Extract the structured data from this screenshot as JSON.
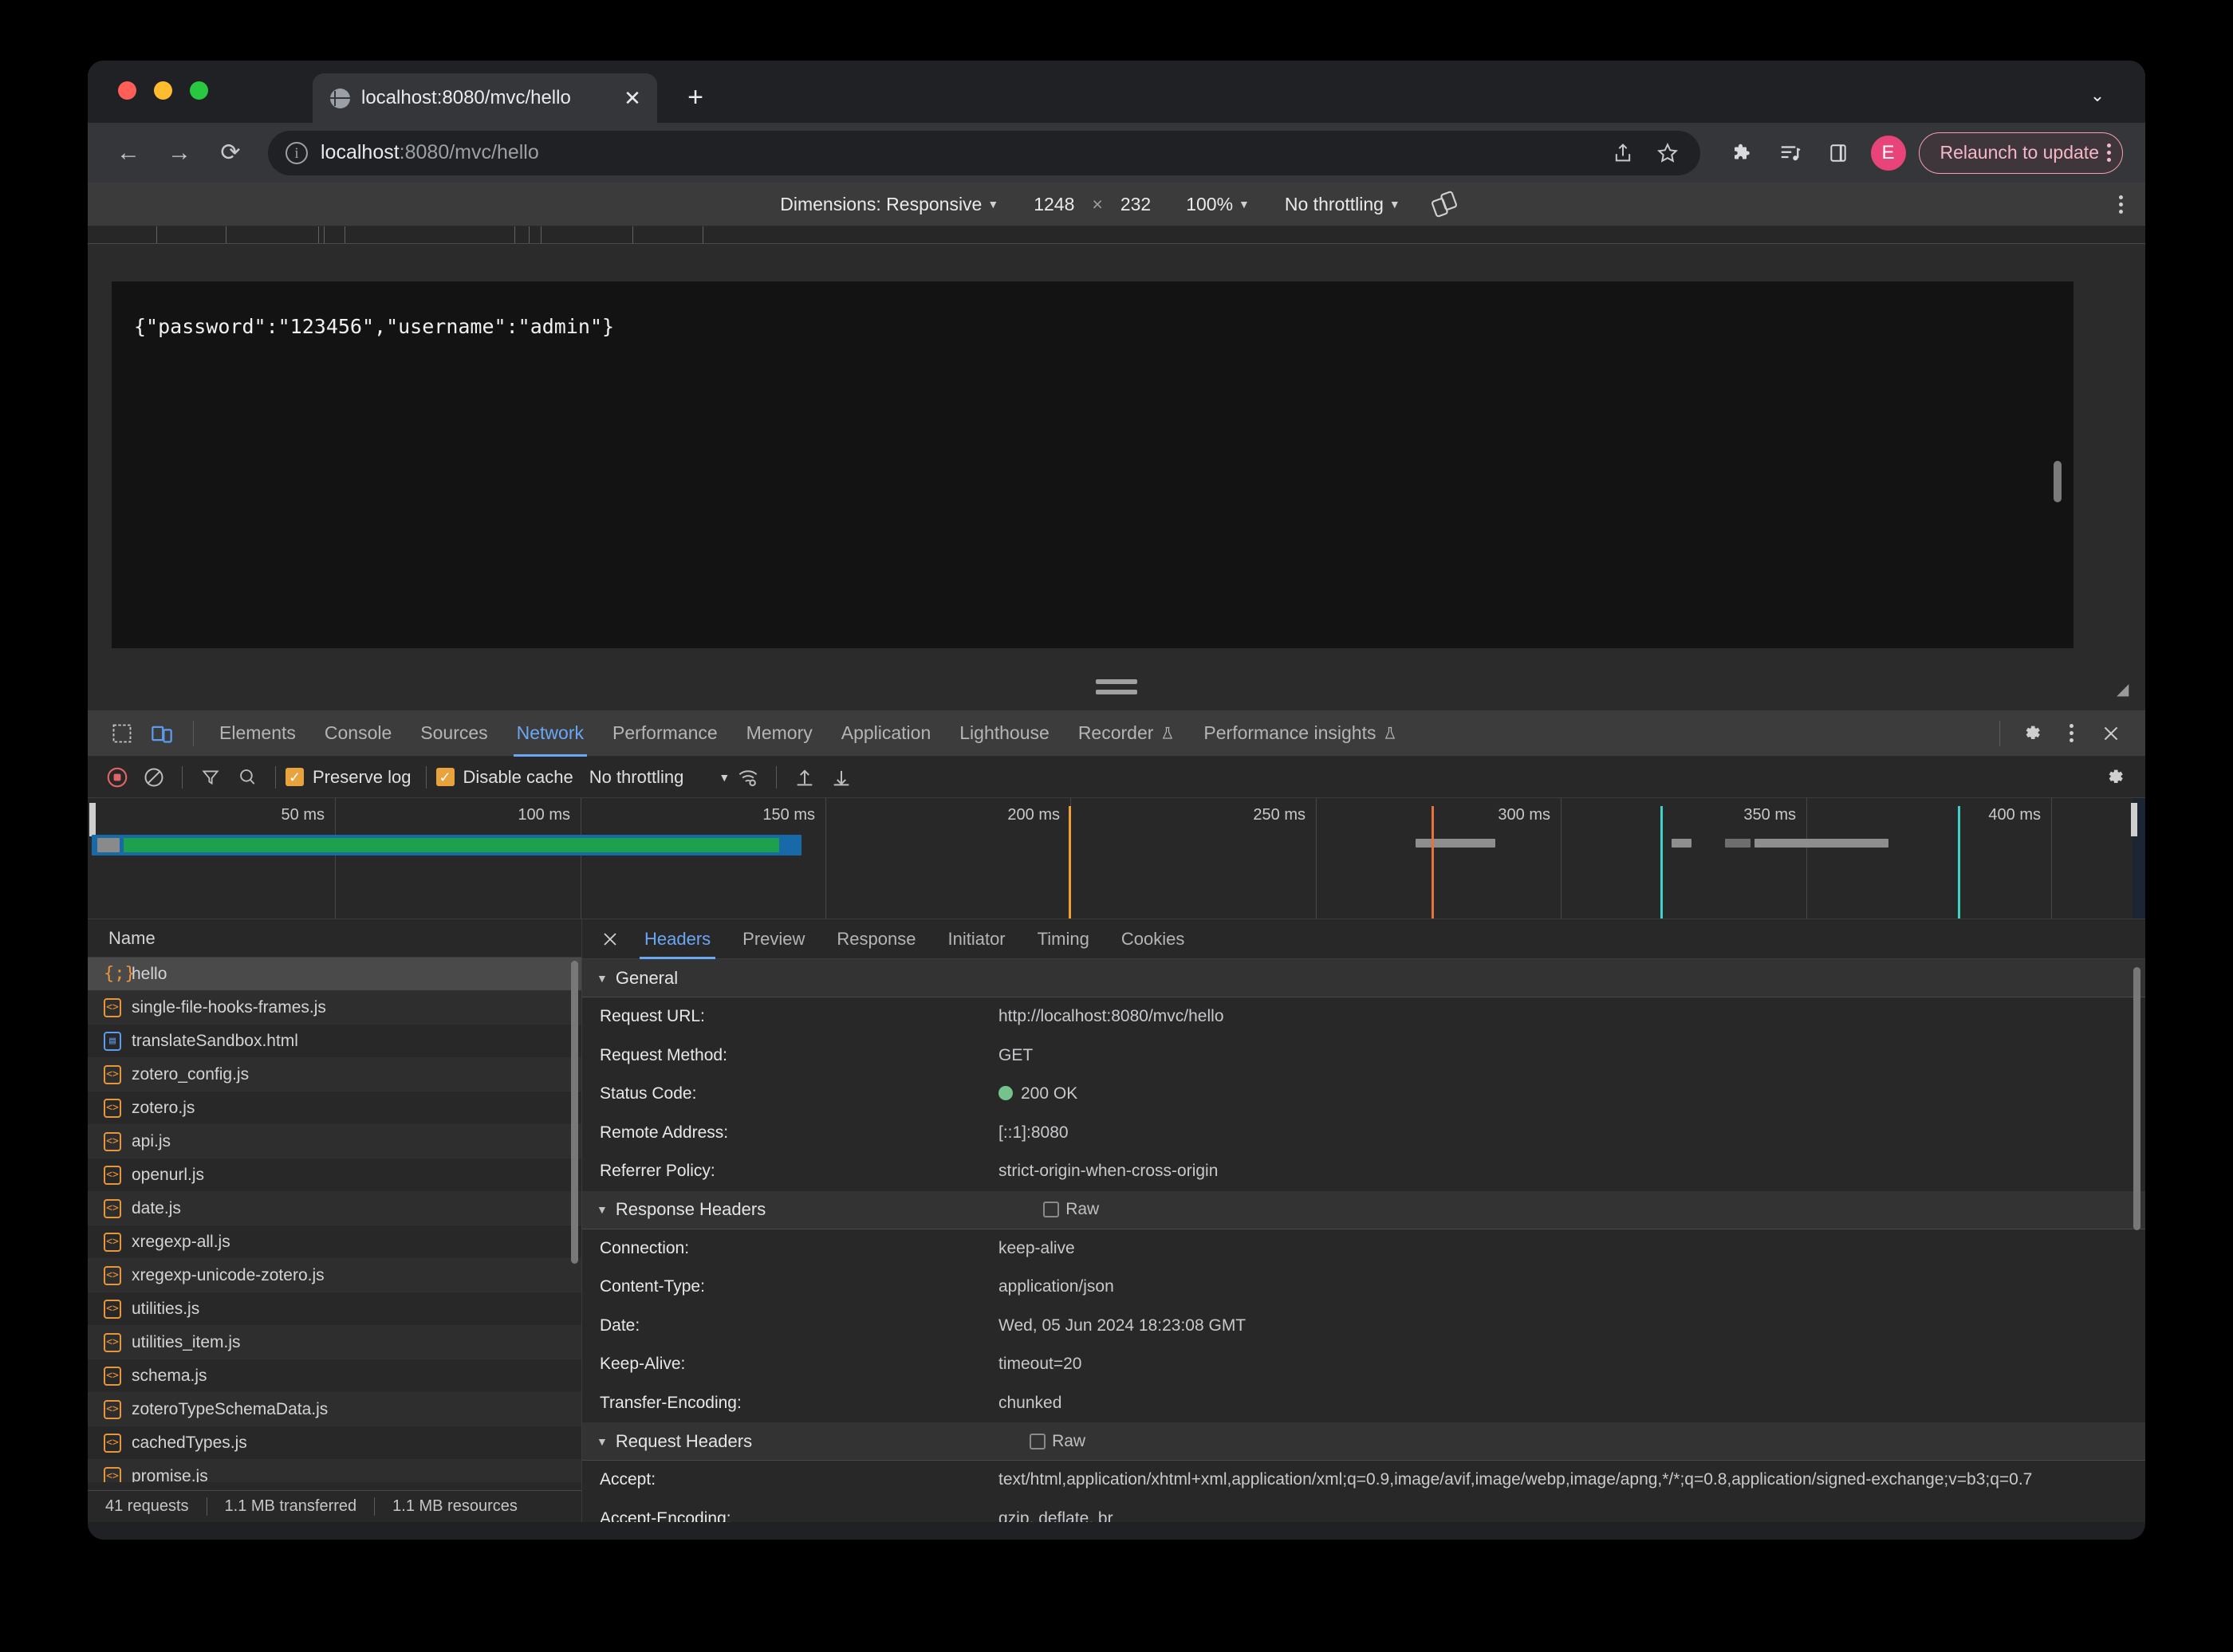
{
  "browser": {
    "tab": {
      "title": "localhost:8080/mvc/hello",
      "favicon": "globe-icon",
      "close": "✕"
    },
    "new_tab": "+",
    "tab_list_chevron": "⌄",
    "nav": {
      "back": "←",
      "forward": "→",
      "reload": "⟳"
    },
    "omnibox": {
      "site_info_icon": "info-icon",
      "url_bold": "localhost",
      "url_rest": ":8080/mvc/hello",
      "full_url": "localhost:8080/mvc/hello"
    },
    "toolbar": {
      "share_icon": "share-icon",
      "bookmark_icon": "star-icon",
      "extensions_icon": "puzzle-icon",
      "reading_list_icon": "media-list-icon",
      "side_panel_icon": "side-panel-icon",
      "profile_initial": "E",
      "relaunch_label": "Relaunch to update",
      "relaunch_menu": "kebab-icon",
      "relaunch_color": "#f6b8c8"
    }
  },
  "device_toolbar": {
    "dimensions_label": "Dimensions: Responsive",
    "width": "1248",
    "times": "×",
    "height": "232",
    "zoom": "100%",
    "throttling": "No throttling",
    "rotate_icon": "rotate-icon",
    "menu_icon": "kebab-icon"
  },
  "viewport": {
    "body_text": "{\"password\":\"123456\",\"username\":\"admin\"}"
  },
  "devtools": {
    "inspect_icon": "inspect-icon",
    "device_toggle_icon": "device-toolbar-icon",
    "tabs": [
      {
        "label": "Elements",
        "active": false,
        "flask": false
      },
      {
        "label": "Console",
        "active": false,
        "flask": false
      },
      {
        "label": "Sources",
        "active": false,
        "flask": false
      },
      {
        "label": "Network",
        "active": true,
        "flask": false
      },
      {
        "label": "Performance",
        "active": false,
        "flask": false
      },
      {
        "label": "Memory",
        "active": false,
        "flask": false
      },
      {
        "label": "Application",
        "active": false,
        "flask": false
      },
      {
        "label": "Lighthouse",
        "active": false,
        "flask": false
      },
      {
        "label": "Recorder",
        "active": false,
        "flask": true
      },
      {
        "label": "Performance insights",
        "active": false,
        "flask": true
      }
    ],
    "settings_icon": "gear-icon",
    "more_icon": "kebab-icon",
    "close_icon": "close-icon",
    "accent": "#6ba7f5"
  },
  "network_toolbar": {
    "record_icon": "record-stop-icon",
    "clear_icon": "clear-icon",
    "filter_icon": "filter-icon",
    "search_icon": "search-icon",
    "preserve_log": {
      "label": "Preserve log",
      "checked": true
    },
    "disable_cache": {
      "label": "Disable cache",
      "checked": true
    },
    "throttling": "No throttling",
    "wifi_icon": "network-conditions-icon",
    "import_icon": "import-har-icon",
    "export_icon": "export-har-icon",
    "settings_icon": "gear-icon",
    "checkbox_color": "#e8a33d"
  },
  "overview": {
    "ticks": [
      "50 ms",
      "100 ms",
      "150 ms",
      "200 ms",
      "250 ms",
      "300 ms",
      "350 ms",
      "400 ms"
    ],
    "bars": [
      {
        "left_pct": 0.2,
        "width_pct": 34.5,
        "color": "#1a73a7"
      },
      {
        "left_pct": 1.3,
        "width_pct": 32.2,
        "color": "#1ea14c"
      },
      {
        "left_pct": 64.5,
        "width_pct": 3.5,
        "color": "#8a8a8a"
      },
      {
        "left_pct": 83.2,
        "width_pct": 1.0,
        "color": "#8a8a8a"
      },
      {
        "left_pct": 86.7,
        "width_pct": 1.2,
        "color": "#6e6e6e"
      },
      {
        "left_pct": 88.5,
        "width_pct": 6.8,
        "color": "#8a8a8a"
      }
    ],
    "markers": [
      {
        "left_pct": 48.6,
        "color": "#f0a030"
      },
      {
        "left_pct": 66.8,
        "color": "#e8713c"
      },
      {
        "left_pct": 82.5,
        "color": "#3fd2c7"
      },
      {
        "left_pct": 99.2,
        "color": "#3fd2c7"
      }
    ]
  },
  "request_list": {
    "column_header": "Name",
    "rows": [
      {
        "name": "hello",
        "type": "json",
        "selected": true
      },
      {
        "name": "single-file-hooks-frames.js",
        "type": "js",
        "selected": false
      },
      {
        "name": "translateSandbox.html",
        "type": "html",
        "selected": false
      },
      {
        "name": "zotero_config.js",
        "type": "js",
        "selected": false
      },
      {
        "name": "zotero.js",
        "type": "js",
        "selected": false
      },
      {
        "name": "api.js",
        "type": "js",
        "selected": false
      },
      {
        "name": "openurl.js",
        "type": "js",
        "selected": false
      },
      {
        "name": "date.js",
        "type": "js",
        "selected": false
      },
      {
        "name": "xregexp-all.js",
        "type": "js",
        "selected": false
      },
      {
        "name": "xregexp-unicode-zotero.js",
        "type": "js",
        "selected": false
      },
      {
        "name": "utilities.js",
        "type": "js",
        "selected": false
      },
      {
        "name": "utilities_item.js",
        "type": "js",
        "selected": false
      },
      {
        "name": "schema.js",
        "type": "js",
        "selected": false
      },
      {
        "name": "zoteroTypeSchemaData.js",
        "type": "js",
        "selected": false
      },
      {
        "name": "cachedTypes.js",
        "type": "js",
        "selected": false
      },
      {
        "name": "promise.js",
        "type": "js",
        "selected": false
      }
    ],
    "status": [
      "41 requests",
      "1.1 MB transferred",
      "1.1 MB resources"
    ]
  },
  "details": {
    "close_icon": "close-icon",
    "tabs": [
      {
        "label": "Headers",
        "active": true
      },
      {
        "label": "Preview",
        "active": false
      },
      {
        "label": "Response",
        "active": false
      },
      {
        "label": "Initiator",
        "active": false
      },
      {
        "label": "Timing",
        "active": false
      },
      {
        "label": "Cookies",
        "active": false
      }
    ],
    "sections": [
      {
        "title": "General",
        "raw": null,
        "rows": [
          {
            "key": "Request URL:",
            "value": "http://localhost:8080/mvc/hello",
            "dot": false
          },
          {
            "key": "Request Method:",
            "value": "GET",
            "dot": false
          },
          {
            "key": "Status Code:",
            "value": "200 OK",
            "dot": true
          },
          {
            "key": "Remote Address:",
            "value": "[::1]:8080",
            "dot": false
          },
          {
            "key": "Referrer Policy:",
            "value": "strict-origin-when-cross-origin",
            "dot": false
          }
        ]
      },
      {
        "title": "Response Headers",
        "raw": "Raw",
        "rows": [
          {
            "key": "Connection:",
            "value": "keep-alive",
            "dot": false
          },
          {
            "key": "Content-Type:",
            "value": "application/json",
            "dot": false
          },
          {
            "key": "Date:",
            "value": "Wed, 05 Jun 2024 18:23:08 GMT",
            "dot": false
          },
          {
            "key": "Keep-Alive:",
            "value": "timeout=20",
            "dot": false
          },
          {
            "key": "Transfer-Encoding:",
            "value": "chunked",
            "dot": false
          }
        ]
      },
      {
        "title": "Request Headers",
        "raw": "Raw",
        "rows": [
          {
            "key": "Accept:",
            "value": "text/html,application/xhtml+xml,application/xml;q=0.9,image/avif,image/webp,image/apng,*/*;q=0.8,application/signed-exchange;v=b3;q=0.7",
            "dot": false
          },
          {
            "key": "Accept-Encoding:",
            "value": "gzip, deflate, br",
            "dot": false
          }
        ]
      }
    ],
    "status_dot_color": "#76c28c"
  }
}
